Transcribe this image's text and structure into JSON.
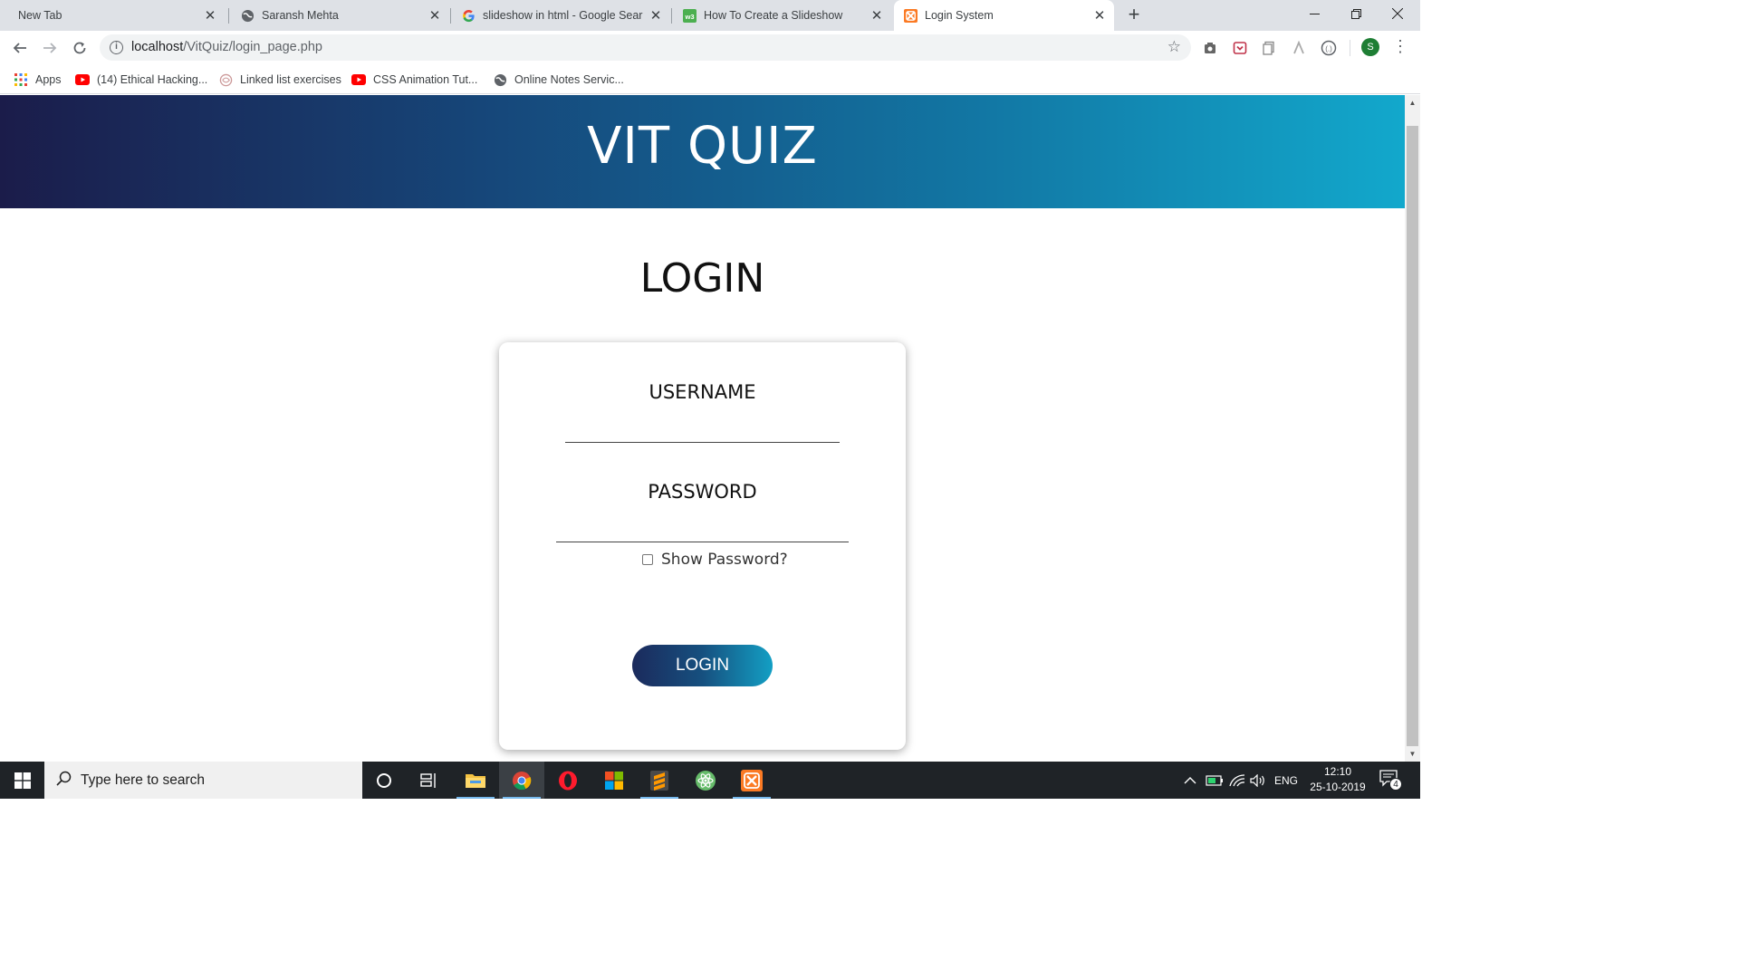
{
  "browser": {
    "tabs": [
      {
        "title": "New Tab",
        "icon": "none",
        "active": false
      },
      {
        "title": "Saransh Mehta",
        "icon": "globe-icon",
        "active": false
      },
      {
        "title": "slideshow in html - Google Searc",
        "icon": "google-icon",
        "active": false
      },
      {
        "title": "How To Create a Slideshow",
        "icon": "w3schools-icon",
        "active": false
      },
      {
        "title": "Login System",
        "icon": "xampp-icon",
        "active": true
      }
    ],
    "url_host": "localhost",
    "url_path": "/VitQuiz/login_page.php",
    "profile_initial": "S",
    "bookmarks": [
      {
        "label": "Apps",
        "icon": "apps-grid-icon"
      },
      {
        "label": "(14) Ethical Hacking...",
        "icon": "youtube-icon"
      },
      {
        "label": "Linked list exercises",
        "icon": "site-icon"
      },
      {
        "label": "CSS Animation Tut...",
        "icon": "youtube-icon"
      },
      {
        "label": "Online Notes Servic...",
        "icon": "globe-icon"
      }
    ]
  },
  "page": {
    "site_title": "VIT QUIZ",
    "heading": "LOGIN",
    "form": {
      "username_label": "USERNAME",
      "password_label": "PASSWORD",
      "show_password_label": "Show Password?",
      "show_password_checked": false,
      "submit_label": "LOGIN"
    },
    "colors": {
      "header_gradient_start": "#1b1c4a",
      "header_gradient_end": "#12a8cc",
      "button_gradient_start": "#1b2a5c",
      "button_gradient_end": "#139fc4"
    }
  },
  "taskbar": {
    "search_placeholder": "Type here to search",
    "pinned": [
      "cortana-icon",
      "task-view-icon",
      "file-explorer-icon",
      "chrome-icon",
      "opera-icon",
      "microsoft-store-icon",
      "sublime-text-icon",
      "atom-icon",
      "xampp-icon"
    ],
    "language": "ENG",
    "time": "12:10",
    "date": "25-10-2019",
    "notification_count": "4"
  }
}
